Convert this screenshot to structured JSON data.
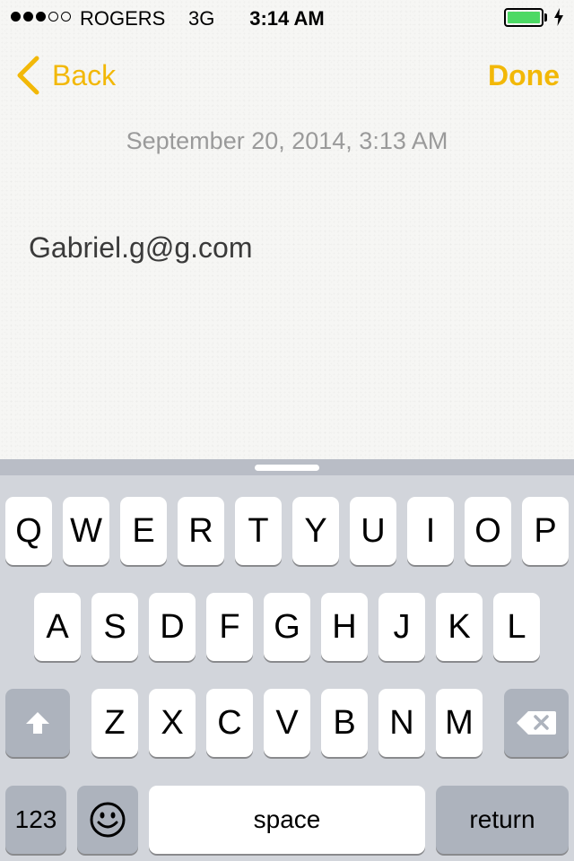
{
  "status_bar": {
    "carrier": "ROGERS",
    "network": "3G",
    "time": "3:14 AM",
    "signal_bars_filled": 3,
    "signal_bars_total": 5,
    "battery_level": 1.0,
    "battery_color": "#4cd964"
  },
  "nav": {
    "back_label": "Back",
    "done_label": "Done",
    "accent_color": "#f2b808"
  },
  "note": {
    "date": "September 20, 2014, 3:13 AM",
    "body": "Gabriel.g@g.com"
  },
  "keyboard": {
    "row1": [
      "Q",
      "W",
      "E",
      "R",
      "T",
      "Y",
      "U",
      "I",
      "O",
      "P"
    ],
    "row2": [
      "A",
      "S",
      "D",
      "F",
      "G",
      "H",
      "J",
      "K",
      "L"
    ],
    "row3": [
      "Z",
      "X",
      "C",
      "V",
      "B",
      "N",
      "M"
    ],
    "numbers_label": "123",
    "space_label": "space",
    "return_label": "return",
    "shift_icon": "shift-arrow-icon",
    "delete_icon": "backspace-icon",
    "emoji_icon": "smiley-icon"
  }
}
